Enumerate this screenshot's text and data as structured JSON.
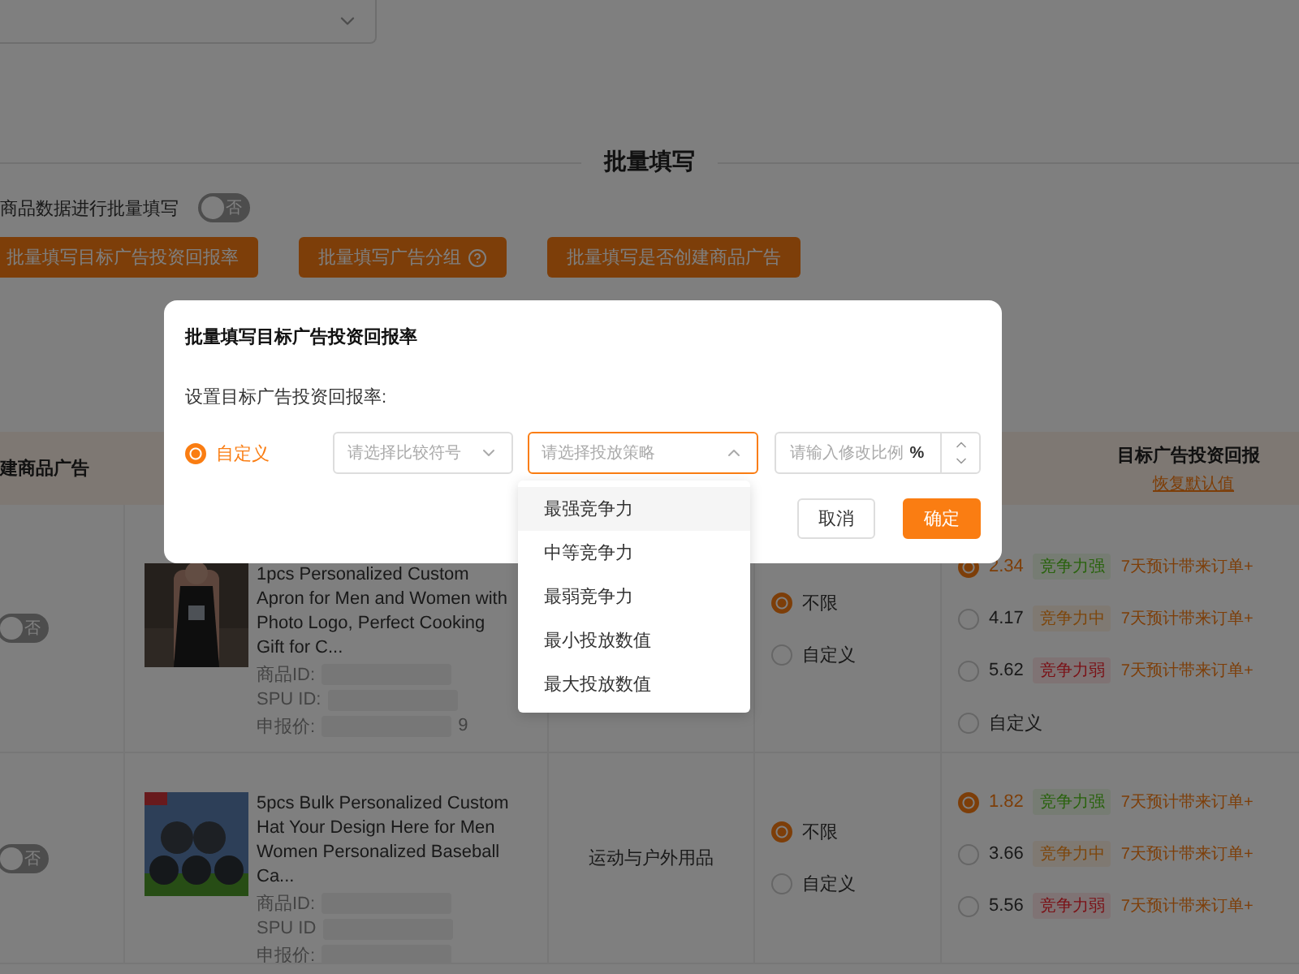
{
  "section_title": "批量填写",
  "bulk_toggle": {
    "label": "商品数据进行批量填写",
    "on": false,
    "text": "否"
  },
  "bulk_buttons": [
    {
      "label": "批量填写目标广告投资回报率",
      "help": false
    },
    {
      "label": "批量填写广告分组",
      "help": true
    },
    {
      "label": "批量填写是否创建商品广告",
      "help": false
    }
  ],
  "table": {
    "header": {
      "create_ad": "建商品广告",
      "roi": "目标广告投资回报",
      "roi_reset": "恢复默认值"
    },
    "rows": [
      {
        "create_ad": {
          "on": false,
          "text": "否"
        },
        "title": "1pcs Personalized Custom Apron for Men and Women with Photo Logo, Perfect Cooking Gift for C...",
        "fields": [
          {
            "label": "商品ID:"
          },
          {
            "label": "SPU ID:"
          },
          {
            "label": "申报价:",
            "tail": "9"
          }
        ],
        "limit_options": [
          {
            "label": "不限",
            "selected": true
          },
          {
            "label": "自定义",
            "selected": false
          }
        ],
        "roi_options": [
          {
            "kind": "preset",
            "value": "2.34",
            "tag": {
              "label": "竞争力强",
              "kind": "strong"
            },
            "note": "7天预计带来订单+",
            "selected": true
          },
          {
            "kind": "preset",
            "value": "4.17",
            "tag": {
              "label": "竞争力中",
              "kind": "medium"
            },
            "note": "7天预计带来订单+",
            "selected": false
          },
          {
            "kind": "preset",
            "value": "5.62",
            "tag": {
              "label": "竞争力弱",
              "kind": "weak"
            },
            "note": "7天预计带来订单+",
            "selected": false
          },
          {
            "kind": "custom",
            "value": "自定义",
            "selected": false
          }
        ]
      },
      {
        "create_ad": {
          "on": false,
          "text": "否"
        },
        "title": "5pcs Bulk Personalized Custom Hat Your Design Here for Men Women Personalized Baseball Ca...",
        "fields": [
          {
            "label": "商品ID:"
          },
          {
            "label": "SPU ID"
          },
          {
            "label": "申报价:"
          }
        ],
        "category": "运动与户外用品",
        "limit_options": [
          {
            "label": "不限",
            "selected": true
          },
          {
            "label": "自定义",
            "selected": false
          }
        ],
        "roi_options": [
          {
            "kind": "preset",
            "value": "1.82",
            "tag": {
              "label": "竞争力强",
              "kind": "strong"
            },
            "note": "7天预计带来订单+",
            "selected": true
          },
          {
            "kind": "preset",
            "value": "3.66",
            "tag": {
              "label": "竞争力中",
              "kind": "medium"
            },
            "note": "7天预计带来订单+",
            "selected": false
          },
          {
            "kind": "preset",
            "value": "5.56",
            "tag": {
              "label": "竞争力弱",
              "kind": "weak"
            },
            "note": "7天预计带来订单+",
            "selected": false
          }
        ]
      }
    ]
  },
  "modal": {
    "title": "批量填写目标广告投资回报率",
    "label": "设置目标广告投资回报率:",
    "mode": {
      "label": "自定义",
      "selected": true
    },
    "compare_select": {
      "placeholder": "请选择比较符号",
      "open": false
    },
    "strategy_select": {
      "placeholder": "请选择投放策略",
      "open": true,
      "options": [
        {
          "label": "最强竞争力",
          "hovered": true
        },
        {
          "label": "中等竞争力",
          "hovered": false
        },
        {
          "label": "最弱竞争力",
          "hovered": false
        },
        {
          "label": "最小投放数值",
          "hovered": false
        },
        {
          "label": "最大投放数值",
          "hovered": false
        }
      ]
    },
    "ratio_input": {
      "placeholder": "请输入修改比例",
      "unit": "%"
    },
    "buttons": [
      {
        "label": "取消",
        "kind": "default"
      },
      {
        "label": "确定",
        "kind": "primary"
      }
    ]
  }
}
